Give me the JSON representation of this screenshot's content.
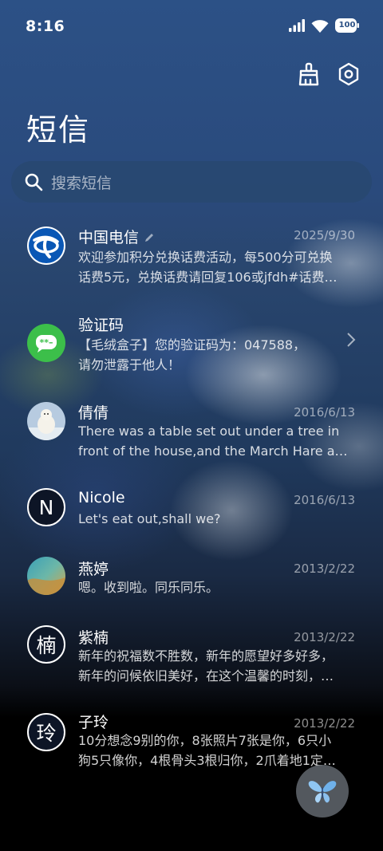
{
  "status_bar": {
    "time": "8:16",
    "battery": "100"
  },
  "header": {
    "title": "短信",
    "clean_icon": "broom-icon",
    "settings_icon": "hexagon-gear-icon"
  },
  "search": {
    "placeholder": "搜索短信"
  },
  "conversations": [
    {
      "name": "中国电信",
      "date": "2025/9/30",
      "preview_line1": "欢迎参加积分兑换话费活动，每500分可兑换",
      "preview_line2": "话费5元，兑换话费请回复106或jfdh#话费…"
    },
    {
      "name": "验证码",
      "date": "",
      "preview_line1": "【毛绒盒子】您的验证码为：047588，",
      "preview_line2": "请勿泄露于他人！"
    },
    {
      "name": "倩倩",
      "date": "2016/6/13",
      "preview_line1": "There was a table set out under a tree in",
      "preview_line2": "front of the house,and the March Hare an…"
    },
    {
      "name": "Nicole",
      "avatar_letter": "N",
      "date": "2016/6/13",
      "preview_line1": "Let's eat out,shall we?",
      "preview_line2": ""
    },
    {
      "name": "燕婷",
      "date": "2013/2/22",
      "preview_line1": "嗯。收到啦。同乐同乐。",
      "preview_line2": ""
    },
    {
      "name": "紫楠",
      "avatar_letter": "楠",
      "date": "2013/2/22",
      "preview_line1": "新年的祝福数不胜数，新年的愿望好多好多，",
      "preview_line2": "新年的问候依旧美好，在这个温馨的时刻，…"
    },
    {
      "name": "子玲",
      "avatar_letter": "玲",
      "date": "2013/2/22",
      "preview_line1": "10分想念9别的你，8张照片7张是你，6只小",
      "preview_line2": "狗5只像你，4根骨头3根归你，2爪着地1定…"
    }
  ],
  "colors": {
    "brand_blue": "#0a57b5",
    "sms_green": "#3cbf4a",
    "background_top": "#2c5186"
  }
}
